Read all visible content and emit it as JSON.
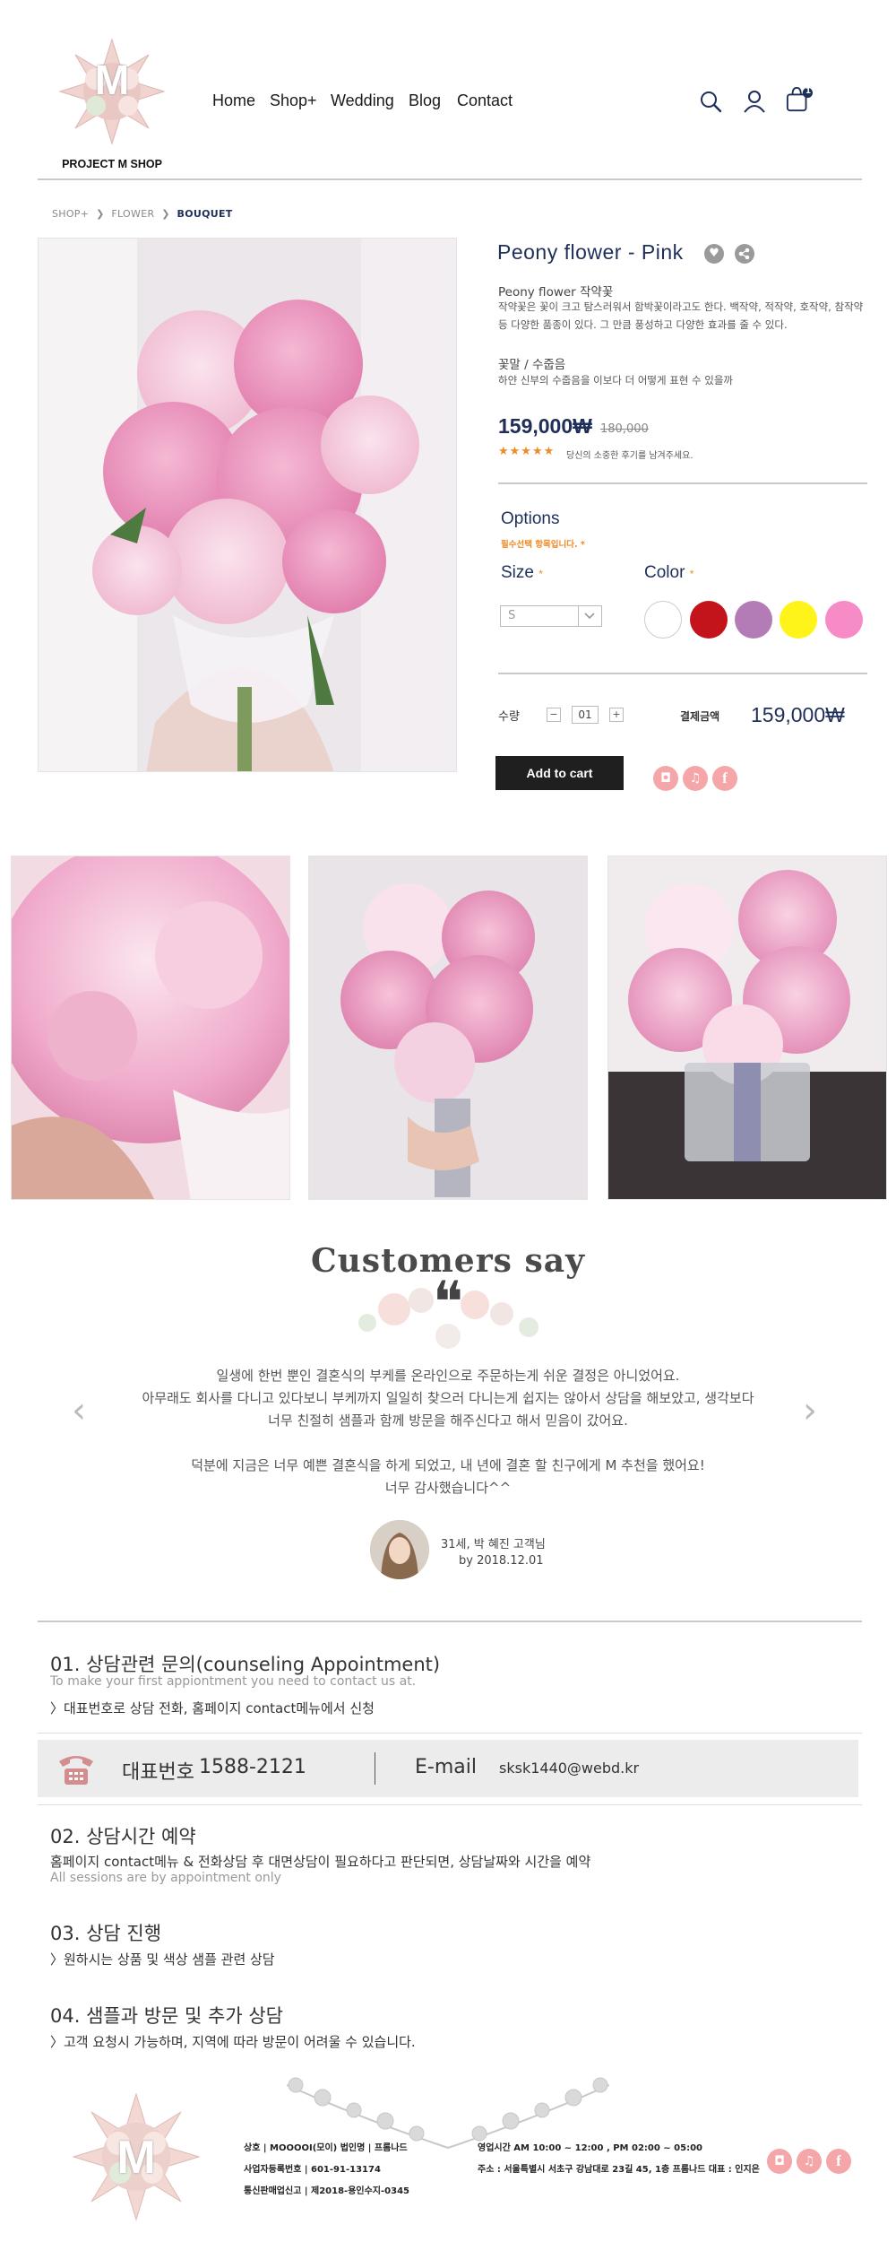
{
  "brand": {
    "name": "PROJECT M SHOP",
    "letter": "M"
  },
  "nav": [
    "Home",
    "Shop+",
    "Wedding",
    "Blog",
    "Contact"
  ],
  "header_icons": [
    "search-icon",
    "user-icon",
    "cart-icon"
  ],
  "cart_count": "1",
  "breadcrumb": {
    "items": [
      "SHOP+",
      "FLOWER",
      "BOUQUET"
    ],
    "separator": "❯"
  },
  "product": {
    "title": "Peony flower - Pink",
    "name_line": "Peony flower 작약꽃",
    "desc": "작약꽃은 꽃이 크고 탐스러워서 함박꽃이라고도 한다. 백작약, 적작약, 호작약, 참작약 등 다양한 품종이 있다. 그 만큼 풍성하고 다양한 효과를 줄 수 있다.",
    "sub_title": "꽃말 / 수줍음",
    "sub_desc": "하얀 신부의 수줍음을 이보다 더 어떻게 표현 수 있을까",
    "price": "159,000₩",
    "old_price": "180,000",
    "rating_stars": "★★★★★",
    "rating": 5,
    "review_text": "당신의 소중한 후기를 남겨주세요.",
    "options_title": "Options",
    "options_note": "필수선택 항목입니다. *",
    "size_label": "Size",
    "size_value": "S",
    "color_label": "Color",
    "colors": [
      "#ffffff",
      "#c4141b",
      "#b47cb6",
      "#fff41a",
      "#f78bc8"
    ],
    "qty_label": "수량",
    "qty_minus": "−",
    "qty_value": "01",
    "qty_plus": "+",
    "total_label": "결제금액",
    "total_value": "159,000₩",
    "add_to_cart": "Add to cart",
    "social": [
      "instagram-icon",
      "twitter-icon",
      "facebook-icon"
    ]
  },
  "customers": {
    "title": "Customers say",
    "quote_mark": "❝",
    "lines": [
      "일생에 한번 뿐인 결혼식의 부케를 온라인으로 주문하는게 쉬운 결정은 아니었어요.",
      "아무래도 회사를 다니고 있다보니 부케까지 일일히 찾으러 다니는게 쉽지는 않아서 상담을 해보았고, 생각보다",
      "너무 친절히 샘플과 함께 방문을 해주신다고 해서 믿음이 갔어요.",
      "",
      "덕분에 지금은 너무 예쁜 결혼식을 하게 되었고, 내 년에 결혼 할 친구에게 M 추천을 했어요!",
      "너무 감사했습니다^^"
    ],
    "reviewer": "31세, 박 혜진 고객님",
    "date": "by 2018.12.01"
  },
  "steps": [
    {
      "title": "01. 상담관련 문의(counseling Appointment)",
      "en": "To make your first appiontment you need to contact us at.",
      "text": "〉대표번호로 상담 전화, 홈페이지 contact메뉴에서 신청"
    },
    {
      "title": "02. 상담시간 예약",
      "text": "홈페이지 contact메뉴 & 전화상담 후 대면상담이 필요하다고 판단되면, 상담날짜와 시간을 예약",
      "en": "All sessions are by appointment only"
    },
    {
      "title": "03. 상담 진행",
      "text": "〉원하시는 상품 및 색상 샘플 관련 상담"
    },
    {
      "title": "04. 샘플과 방문 및 추가 상담",
      "text": "〉고객 요청시 가능하며, 지역에 따라 방문이 어려울 수 있습니다."
    }
  ],
  "contact": {
    "phone_label": "대표번호",
    "phone": "1588-2121",
    "email_label": "E-mail",
    "email": "sksk1440@webd.kr"
  },
  "footer": {
    "company": "상호 | MOOOOI(모이)   법인명 | 프롬나드",
    "biz_no": "사업자등록번호 | 601-91-13174",
    "mail_order": "통신판매업신고 | 제2018-용인수지-0345",
    "hours": "영업시간 AM 10:00 ~ 12:00 , PM 02:00 ~ 05:00",
    "address": "주소 : 서울특별시 서초구 강남대로 23길 45, 1층 프롬나드 대표 : 인지은"
  },
  "colors": {
    "navy": "#1f2f5a",
    "accent": "#f08a24",
    "social_pink": "#f4a6a8"
  }
}
